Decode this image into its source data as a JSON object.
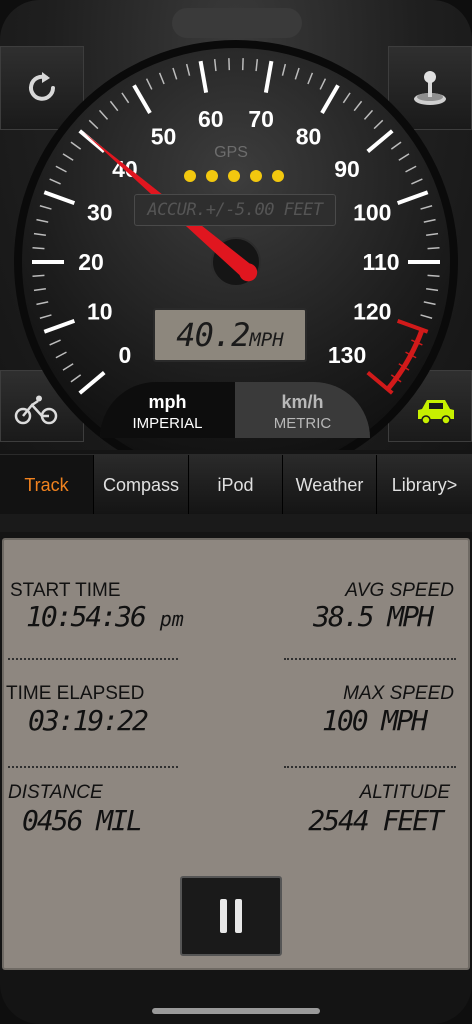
{
  "gauge": {
    "unit_label": "mph",
    "speed_reading": 40.2,
    "max_value": 130,
    "tick_labels": [
      "0",
      "10",
      "20",
      "30",
      "40",
      "50",
      "60",
      "70",
      "80",
      "90",
      "100",
      "110",
      "120",
      "130"
    ],
    "gps_label": "GPS",
    "gps_dots": 5,
    "accuracy_text": "ACCUR.+/-5.00 FEET",
    "speed_display": "40.2",
    "speed_display_unit": "MPH",
    "colors": {
      "needle": "#e0161f",
      "redline": "#d11a1a",
      "gps_dot": "#f2c80f",
      "car_icon": "#c7f000"
    }
  },
  "units": {
    "imperial": {
      "main": "mph",
      "sub": "IMPERIAL",
      "selected": true
    },
    "metric": {
      "main": "km/h",
      "sub": "METRIC",
      "selected": false
    }
  },
  "icons": {
    "reset": "refresh-icon",
    "joystick": "joystick-icon",
    "bicycle": "bicycle-icon",
    "car": "car-icon"
  },
  "tabs": [
    {
      "label": "Track",
      "active": true
    },
    {
      "label": "Compass",
      "active": false
    },
    {
      "label": "iPod",
      "active": false
    },
    {
      "label": "Weather",
      "active": false
    },
    {
      "label": "Library>",
      "active": false
    }
  ],
  "stats": {
    "start_time": {
      "label": "START TIME",
      "value": "10:54:36",
      "suffix": "pm"
    },
    "avg_speed": {
      "label": "AVG SPEED",
      "value": "38.5 MPH"
    },
    "time_elapsed": {
      "label": "TIME ELAPSED",
      "value": "03:19:22"
    },
    "max_speed": {
      "label": "MAX SPEED",
      "value": "100 MPH"
    },
    "distance": {
      "label": "DISTANCE",
      "value": "0456 MIL"
    },
    "altitude": {
      "label": "ALTITUDE",
      "value": "2544 FEET"
    }
  },
  "controls": {
    "pause": "pause-icon"
  }
}
